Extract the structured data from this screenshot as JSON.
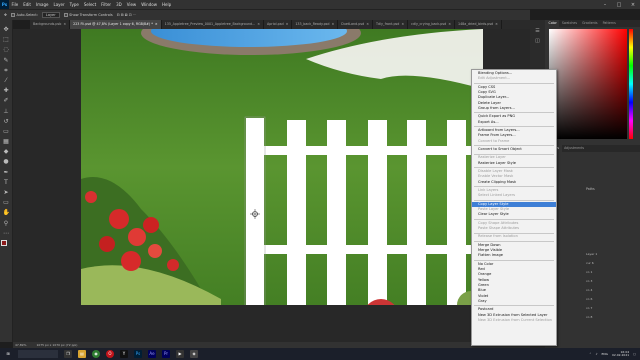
{
  "menubar": {
    "logo": "Ps",
    "items": [
      "File",
      "Edit",
      "Image",
      "Layer",
      "Type",
      "Select",
      "Filter",
      "3D",
      "View",
      "Window",
      "Help"
    ]
  },
  "options": {
    "auto_select_label": "Auto-Select:",
    "auto_select_value": "Layer",
    "show_transform_label": "Show Transform Controls"
  },
  "tabs": [
    {
      "label": "Backgrounds.psb",
      "active": false
    },
    {
      "label": "223 Fli.psd @ 47,8% (Layer 1 copy 6, RGB/8#) *",
      "active": true
    },
    {
      "label": "135_Appletree_Preview_0001_Appletree_Background...",
      "active": false
    },
    {
      "label": "Apriol.psd",
      "active": false
    },
    {
      "label": "133_back_Ready.psd",
      "active": false
    },
    {
      "label": "DuetLand.psd",
      "active": false
    },
    {
      "label": "Tdly_front.psd",
      "active": false
    },
    {
      "label": "cdly_crying_back.psd",
      "active": false
    },
    {
      "label": "148a_dried_birds.psd",
      "active": false
    }
  ],
  "status": {
    "zoom": "47,89%",
    "doc": "1075 px x 1070 px (72 ppi)"
  },
  "panels": {
    "top_tabs": [
      "Color",
      "Swatches",
      "Gradients",
      "Patterns"
    ],
    "mid_tabs": [
      "Layers",
      "Adjustments"
    ],
    "paths_label": "Paths",
    "layers": [
      "Layer 1",
      "cur 6",
      "co 1",
      "co 3",
      "co 4",
      "co 6",
      "co 7",
      "co 8"
    ]
  },
  "context_menu": {
    "groups": [
      [
        {
          "label": "Blending Options...",
          "disabled": false
        },
        {
          "label": "Edit Adjustment...",
          "disabled": true
        }
      ],
      [
        {
          "label": "Copy CSS",
          "disabled": false
        },
        {
          "label": "Copy SVG",
          "disabled": false
        },
        {
          "label": "Duplicate Layer...",
          "disabled": false
        },
        {
          "label": "Delete Layer",
          "disabled": false
        },
        {
          "label": "Group from Layers...",
          "disabled": false
        }
      ],
      [
        {
          "label": "Quick Export as PNG",
          "disabled": false
        },
        {
          "label": "Export As...",
          "disabled": false
        }
      ],
      [
        {
          "label": "Artboard from Layers...",
          "disabled": false
        },
        {
          "label": "Frame From Layers...",
          "disabled": false
        },
        {
          "label": "Convert to Frame",
          "disabled": true
        }
      ],
      [
        {
          "label": "Convert to Smart Object",
          "disabled": false
        }
      ],
      [
        {
          "label": "Rasterize Layer",
          "disabled": true
        },
        {
          "label": "Rasterize Layer Style",
          "disabled": false
        }
      ],
      [
        {
          "label": "Disable Layer Mask",
          "disabled": true
        },
        {
          "label": "Enable Vector Mask",
          "disabled": true
        },
        {
          "label": "Create Clipping Mask",
          "disabled": false
        }
      ],
      [
        {
          "label": "Link Layers",
          "disabled": true
        },
        {
          "label": "Select Linked Layers",
          "disabled": true
        }
      ],
      [
        {
          "label": "Copy Layer Style",
          "disabled": false,
          "highlight": true
        },
        {
          "label": "Paste Layer Style",
          "disabled": true
        },
        {
          "label": "Clear Layer Style",
          "disabled": false
        }
      ],
      [
        {
          "label": "Copy Shape Attributes",
          "disabled": true
        },
        {
          "label": "Paste Shape Attributes",
          "disabled": true
        }
      ],
      [
        {
          "label": "Release from Isolation",
          "disabled": true
        }
      ],
      [
        {
          "label": "Merge Down",
          "disabled": false
        },
        {
          "label": "Merge Visible",
          "disabled": false
        },
        {
          "label": "Flatten Image",
          "disabled": false
        }
      ],
      [
        {
          "label": "No Color",
          "disabled": false
        },
        {
          "label": "Red",
          "disabled": false
        },
        {
          "label": "Orange",
          "disabled": false
        },
        {
          "label": "Yellow",
          "disabled": false
        },
        {
          "label": "Green",
          "disabled": false
        },
        {
          "label": "Blue",
          "disabled": false
        },
        {
          "label": "Violet",
          "disabled": false
        },
        {
          "label": "Gray",
          "disabled": false
        }
      ],
      [
        {
          "label": "Postcard",
          "disabled": false
        },
        {
          "label": "New 3D Extrusion from Selected Layer",
          "disabled": false
        },
        {
          "label": "New 3D Extrusion from Current Selection",
          "disabled": true
        }
      ]
    ]
  },
  "taskbar": {
    "search": "",
    "time": "16:04",
    "date": "02.02.2021",
    "lang": "ENG"
  },
  "colors": {
    "accent": "#3e7fd6",
    "grass": "#4f8a2a",
    "fence": "#ffffff",
    "rose": "#d62a2a"
  }
}
